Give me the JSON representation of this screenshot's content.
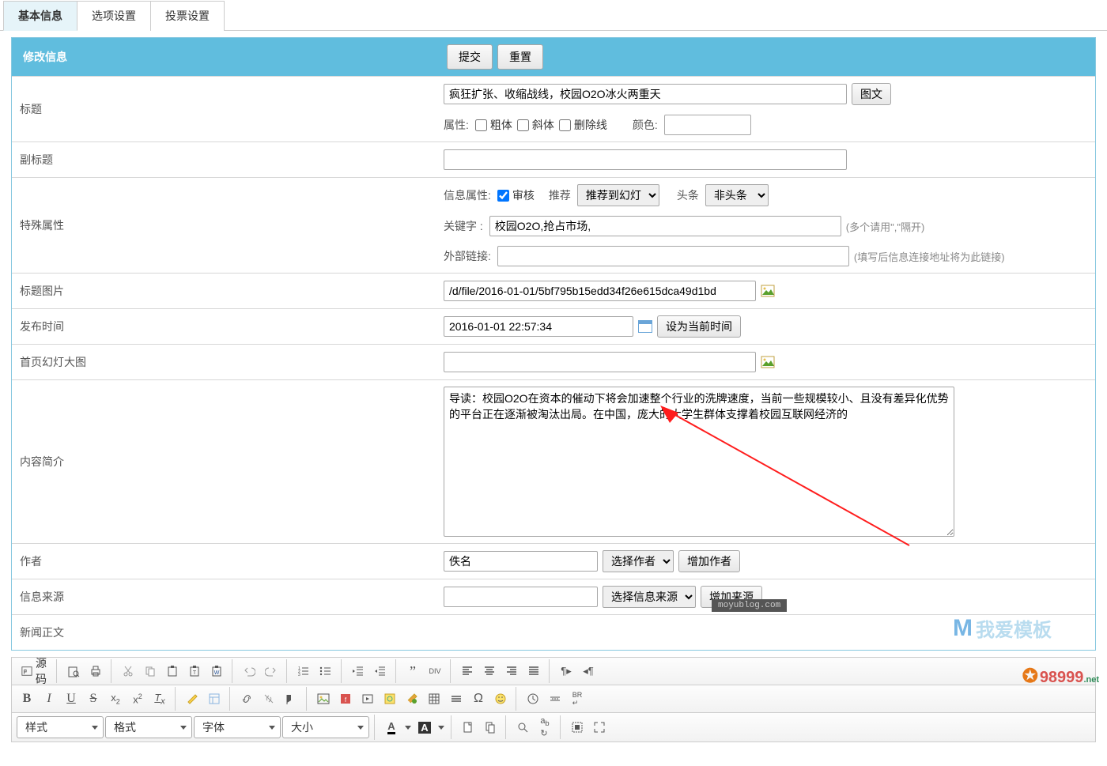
{
  "tabs": {
    "basic": "基本信息",
    "options": "选项设置",
    "vote": "投票设置"
  },
  "panel": {
    "title": "修改信息",
    "submit": "提交",
    "reset": "重置"
  },
  "labels": {
    "title": "标题",
    "subtitle": "副标题",
    "special": "特殊属性",
    "titleImage": "标题图片",
    "publishTime": "发布时间",
    "homeSlide": "首页幻灯大图",
    "summary": "内容简介",
    "author": "作者",
    "source": "信息来源",
    "body": "新闻正文"
  },
  "title": {
    "value": "疯狂扩张、收缩战线，校园O2O冰火两重天",
    "imgText": "图文",
    "attr": "属性:",
    "bold": "粗体",
    "italic": "斜体",
    "strike": "删除线",
    "color": "颜色:"
  },
  "subtitle": {
    "value": ""
  },
  "special": {
    "infoAttr": "信息属性:",
    "audit": "审核",
    "recommend": "推荐",
    "recOption": "推荐到幻灯",
    "headline": "头条",
    "headlineOption": "非头条",
    "kwLabel": "关键字   :",
    "kwValue": "校园O2O,抢占市场,",
    "kwHint": "(多个请用\",\"隔开)",
    "extLink": "外部链接:",
    "extHint": "(填写后信息连接地址将为此链接)"
  },
  "titleImage": {
    "value": "/d/file/2016-01-01/5bf795b15edd34f26e615dca49d1bd"
  },
  "publishTime": {
    "value": "2016-01-01 22:57:34",
    "setNow": "设为当前时间"
  },
  "homeSlide": {
    "value": ""
  },
  "summary": {
    "value": "导读：校园O2O在资本的催动下将会加速整个行业的洗牌速度，当前一些规模较小、且没有差异化优势的平台正在逐渐被淘汰出局。在中国，庞大的大学生群体支撑着校园互联网经济的"
  },
  "author": {
    "value": "佚名",
    "select": "选择作者",
    "add": "增加作者"
  },
  "source": {
    "value": "",
    "select": "选择信息来源",
    "add": "增加来源"
  },
  "editor": {
    "source": "源码",
    "style": "样式",
    "format": "格式",
    "font": "字体",
    "size": "大小"
  },
  "watermark": {
    "moyu": "moyublog.com",
    "love": "我爱模板",
    "num": "98999",
    "net": ".net"
  }
}
